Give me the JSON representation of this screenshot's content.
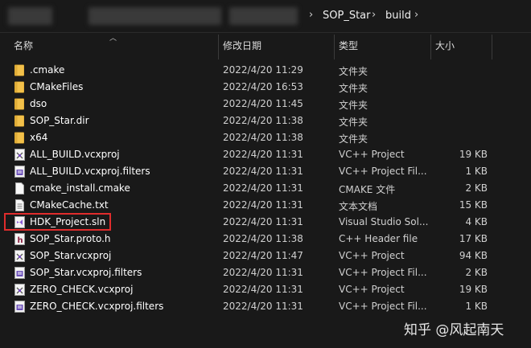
{
  "breadcrumb": {
    "items": [
      "SOP_Star",
      "build"
    ]
  },
  "columns": {
    "name": "名称",
    "date": "修改日期",
    "type": "类型",
    "size": "大小"
  },
  "files": [
    {
      "name": ".cmake",
      "date": "2022/4/20 11:29",
      "type": "文件夹",
      "size": "",
      "icon": "folder-icon"
    },
    {
      "name": "CMakeFiles",
      "date": "2022/4/20 16:53",
      "type": "文件夹",
      "size": "",
      "icon": "folder-icon"
    },
    {
      "name": "dso",
      "date": "2022/4/20 11:45",
      "type": "文件夹",
      "size": "",
      "icon": "folder-icon"
    },
    {
      "name": "SOP_Star.dir",
      "date": "2022/4/20 11:38",
      "type": "文件夹",
      "size": "",
      "icon": "folder-icon"
    },
    {
      "name": "x64",
      "date": "2022/4/20 11:38",
      "type": "文件夹",
      "size": "",
      "icon": "folder-icon"
    },
    {
      "name": "ALL_BUILD.vcxproj",
      "date": "2022/4/20 11:31",
      "type": "VC++ Project",
      "size": "19 KB",
      "icon": "vcxproj-icon"
    },
    {
      "name": "ALL_BUILD.vcxproj.filters",
      "date": "2022/4/20 11:31",
      "type": "VC++ Project Fil...",
      "size": "1 KB",
      "icon": "filters-icon"
    },
    {
      "name": "cmake_install.cmake",
      "date": "2022/4/20 11:31",
      "type": "CMAKE 文件",
      "size": "2 KB",
      "icon": "document-icon"
    },
    {
      "name": "CMakeCache.txt",
      "date": "2022/4/20 11:31",
      "type": "文本文档",
      "size": "15 KB",
      "icon": "text-file-icon"
    },
    {
      "name": "HDK_Project.sln",
      "date": "2022/4/20 11:31",
      "type": "Visual Studio Sol...",
      "size": "4 KB",
      "icon": "solution-icon"
    },
    {
      "name": "SOP_Star.proto.h",
      "date": "2022/4/20 11:38",
      "type": "C++ Header file",
      "size": "17 KB",
      "icon": "header-file-icon"
    },
    {
      "name": "SOP_Star.vcxproj",
      "date": "2022/4/20 11:47",
      "type": "VC++ Project",
      "size": "94 KB",
      "icon": "vcxproj-icon"
    },
    {
      "name": "SOP_Star.vcxproj.filters",
      "date": "2022/4/20 11:31",
      "type": "VC++ Project Fil...",
      "size": "2 KB",
      "icon": "filters-icon"
    },
    {
      "name": "ZERO_CHECK.vcxproj",
      "date": "2022/4/20 11:31",
      "type": "VC++ Project",
      "size": "19 KB",
      "icon": "vcxproj-icon"
    },
    {
      "name": "ZERO_CHECK.vcxproj.filters",
      "date": "2022/4/20 11:31",
      "type": "VC++ Project Fil...",
      "size": "1 KB",
      "icon": "filters-icon"
    }
  ],
  "watermark": "知乎 @风起南天",
  "colors": {
    "background": "#191919",
    "folder": "#f2c04a",
    "highlight_border": "#e02c2c"
  }
}
